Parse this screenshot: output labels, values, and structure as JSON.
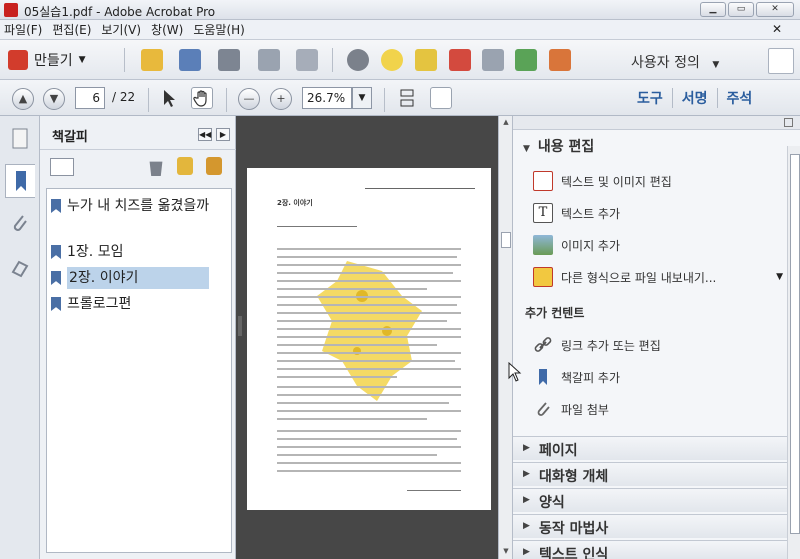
{
  "window": {
    "title": "05실습1.pdf - Adobe Acrobat Pro"
  },
  "menu": [
    "파일(F)",
    "편집(E)",
    "보기(V)",
    "창(W)",
    "도움말(H)"
  ],
  "toolbar": {
    "create_label": "만들기",
    "icons": [
      "open-folder-icon",
      "save-icon",
      "print-icon",
      "edit-icon",
      "email-icon",
      "gear-icon",
      "comment-icon",
      "stamp-icon",
      "pdf-icon",
      "secure-icon",
      "export-icon",
      "form-icon",
      "sign-icon"
    ],
    "custom_label": "사용자 정의"
  },
  "nav": {
    "current_page": "6",
    "total_pages": "/ 22",
    "zoom": "26.7%",
    "panel_tabs": [
      "도구",
      "서명",
      "주석"
    ]
  },
  "bookmarks": {
    "title": "책갈피",
    "items": [
      {
        "label": "누가 내 치즈를 옮겼을까"
      },
      {
        "label": "1장. 모임"
      },
      {
        "label": "2장. 이야기",
        "selected": true
      },
      {
        "label": "프롤로그편"
      }
    ]
  },
  "document": {
    "page_heading": "2장. 이야기"
  },
  "tools_pane": {
    "content_edit": {
      "title": "내용 편집",
      "items": [
        "텍스트 및 이미지 편집",
        "텍스트 추가",
        "이미지 추가",
        "다른 형식으로 파일 내보내기..."
      ]
    },
    "add_content": {
      "title": "추가 컨텐트",
      "items": [
        "링크 추가 또는 편집",
        "책갈피 추가",
        "파일 첨부"
      ]
    },
    "sections": [
      "페이지",
      "대화형 개체",
      "양식",
      "동작 마법사",
      "텍스트 인식"
    ]
  }
}
